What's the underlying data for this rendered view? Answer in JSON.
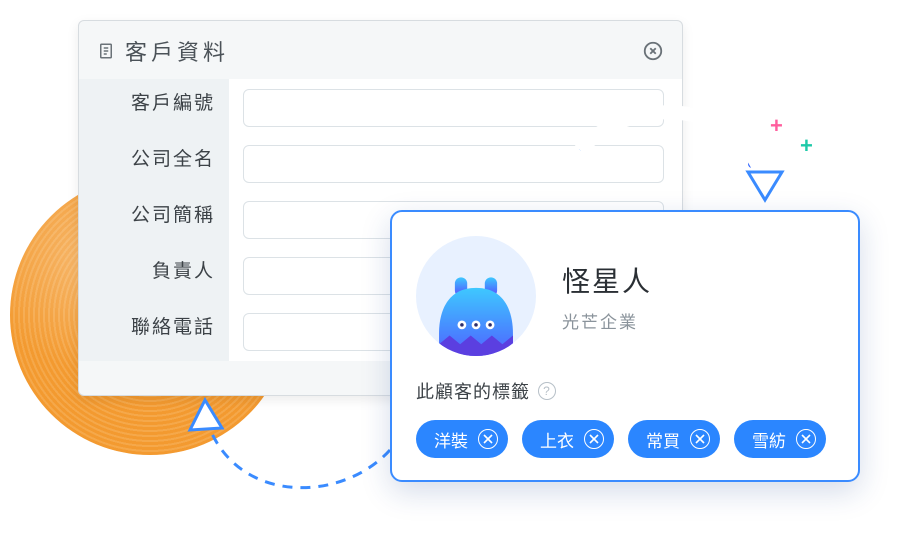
{
  "form": {
    "title": "客戶資料",
    "fields": {
      "customer_id": {
        "label": "客戶編號",
        "value": ""
      },
      "company_full": {
        "label": "公司全名",
        "value": ""
      },
      "company_short": {
        "label": "公司簡稱",
        "value": ""
      },
      "owner": {
        "label": "負責人",
        "value": ""
      },
      "phone": {
        "label": "聯絡電話",
        "value": ""
      }
    }
  },
  "card": {
    "name": "怪星人",
    "company": "光芒企業",
    "tags_label": "此顧客的標籤",
    "tags": [
      {
        "label": "洋裝"
      },
      {
        "label": "上衣"
      },
      {
        "label": "常買"
      },
      {
        "label": "雪紡"
      }
    ]
  }
}
